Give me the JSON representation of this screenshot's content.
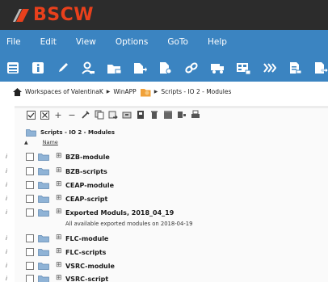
{
  "app": {
    "logo_text": "BSCW"
  },
  "menu": [
    "File",
    "Edit",
    "View",
    "Options",
    "GoTo",
    "Help"
  ],
  "toolbar_icons": [
    "list-icon",
    "info-icon",
    "pencil-icon",
    "users-icon",
    "folder-move-icon",
    "move-to-icon",
    "new-doc-icon",
    "link-icon",
    "truck-icon",
    "grid-icon",
    "stream-icon",
    "document-icon",
    "document-arrow-icon"
  ],
  "breadcrumb": {
    "items": [
      "Workspaces of ValentinaK",
      "WinAPP",
      "Scripts - IO 2 - Modules"
    ]
  },
  "folder": {
    "title": "Scripts - IO 2 - Modules"
  },
  "columns": {
    "name": "Name"
  },
  "rows": [
    {
      "name": "BZB-module"
    },
    {
      "name": "BZB-scripts"
    },
    {
      "name": "CEAP-module"
    },
    {
      "name": "CEAP-script"
    },
    {
      "name": "Exported Moduls, 2018_04_19",
      "description": "All available exported modules on 2018-04-19"
    },
    {
      "name": "FLC-module"
    },
    {
      "name": "FLC-scripts"
    },
    {
      "name": "VSRC-module"
    },
    {
      "name": "VSRC-script"
    }
  ],
  "colors": {
    "header_bg": "#2c2c2c",
    "menu_bg": "#3b84c1",
    "logo": "#e8401c",
    "folder": "#8fb3d6"
  }
}
